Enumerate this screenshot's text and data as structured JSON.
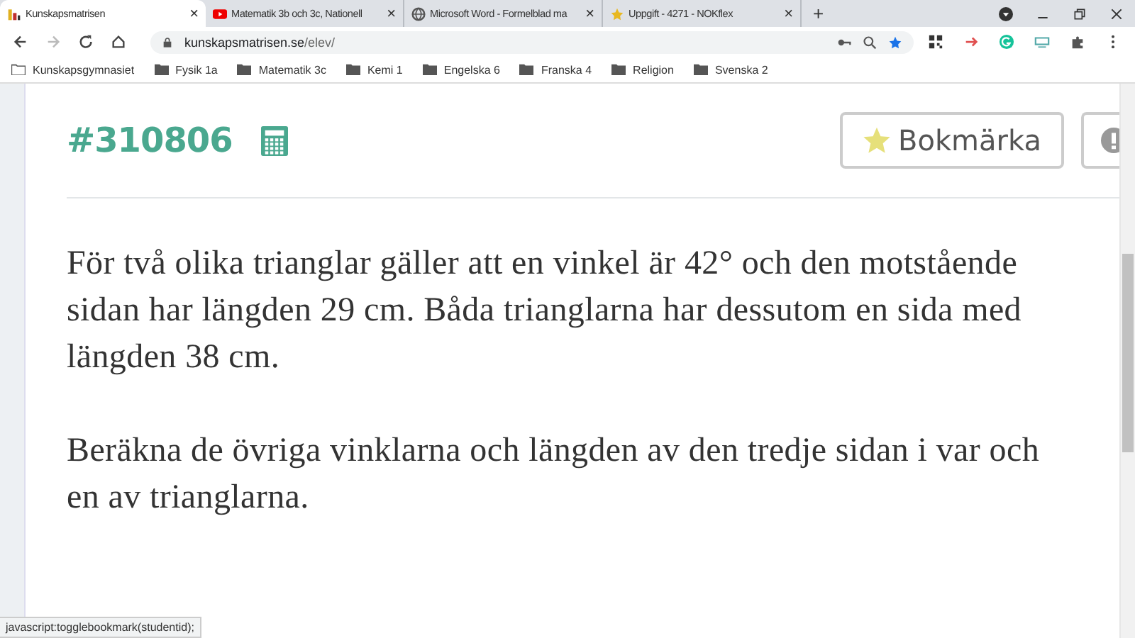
{
  "tabs": [
    {
      "title": "Kunskapsmatrisen",
      "close": "×",
      "selected": true
    },
    {
      "title": "Matematik 3b och 3c, Nationell",
      "close": "×",
      "selected": false
    },
    {
      "title": "Microsoft Word - Formelblad ma",
      "close": "×",
      "selected": false
    },
    {
      "title": "Uppgift - 4271 - NOKflex",
      "close": "×",
      "selected": false
    }
  ],
  "new_tab": "+",
  "address": {
    "domain": "kunskapsmatrisen.se",
    "path": "/elev/"
  },
  "bookmarks": [
    "Kunskapsgymnasiet",
    "Fysik 1a",
    "Matematik 3c",
    "Kemi 1",
    "Engelska 6",
    "Franska 4",
    "Religion",
    "Svenska 2"
  ],
  "task": {
    "id": "#310806",
    "bookmark_button": "Bokmärka",
    "paragraphs": [
      "För två olika trianglar gäller att en vinkel är 42° och den motstående sidan har längden 29 cm. Båda trianglarna har dessutom en sida med längden 38 cm.",
      "Beräkna de övriga vinklarna och längden av den tredje sidan i var och en av trianglarna."
    ]
  },
  "status_bar": "javascript:togglebookmark(studentid);"
}
